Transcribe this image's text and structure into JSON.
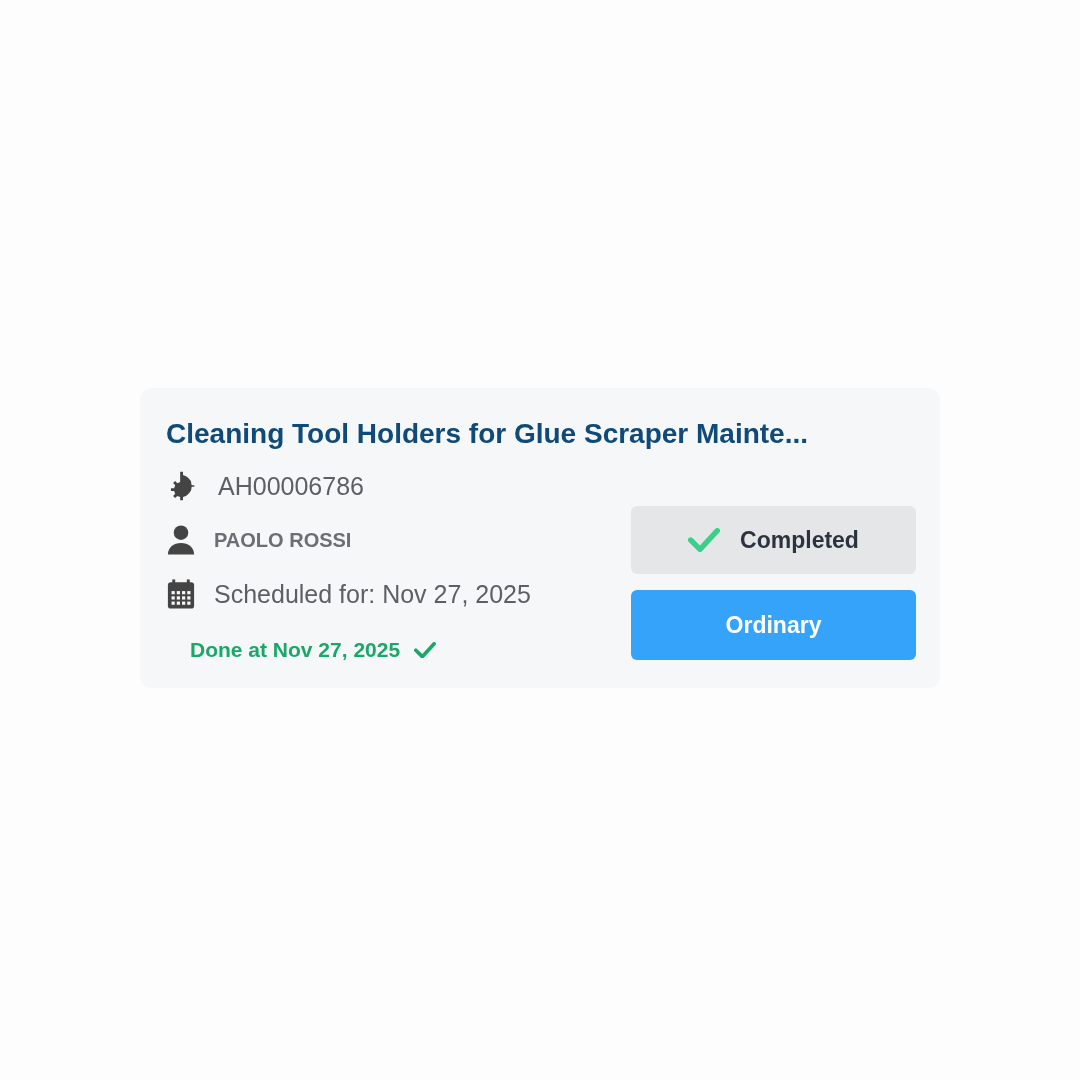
{
  "card": {
    "title": "Cleaning Tool Holders for Glue Scraper Mainte...",
    "details": [
      {
        "kind": "asset",
        "text": "AH00006786"
      },
      {
        "kind": "person",
        "text": "PAOLO ROSSI"
      },
      {
        "kind": "date",
        "text": "Scheduled for: Nov 27, 2025"
      }
    ],
    "done_note": "Done at Nov 27, 2025",
    "status": {
      "kind": "completed",
      "label": "Completed"
    },
    "priority": {
      "kind": "ordinary",
      "label": "Ordinary"
    }
  }
}
